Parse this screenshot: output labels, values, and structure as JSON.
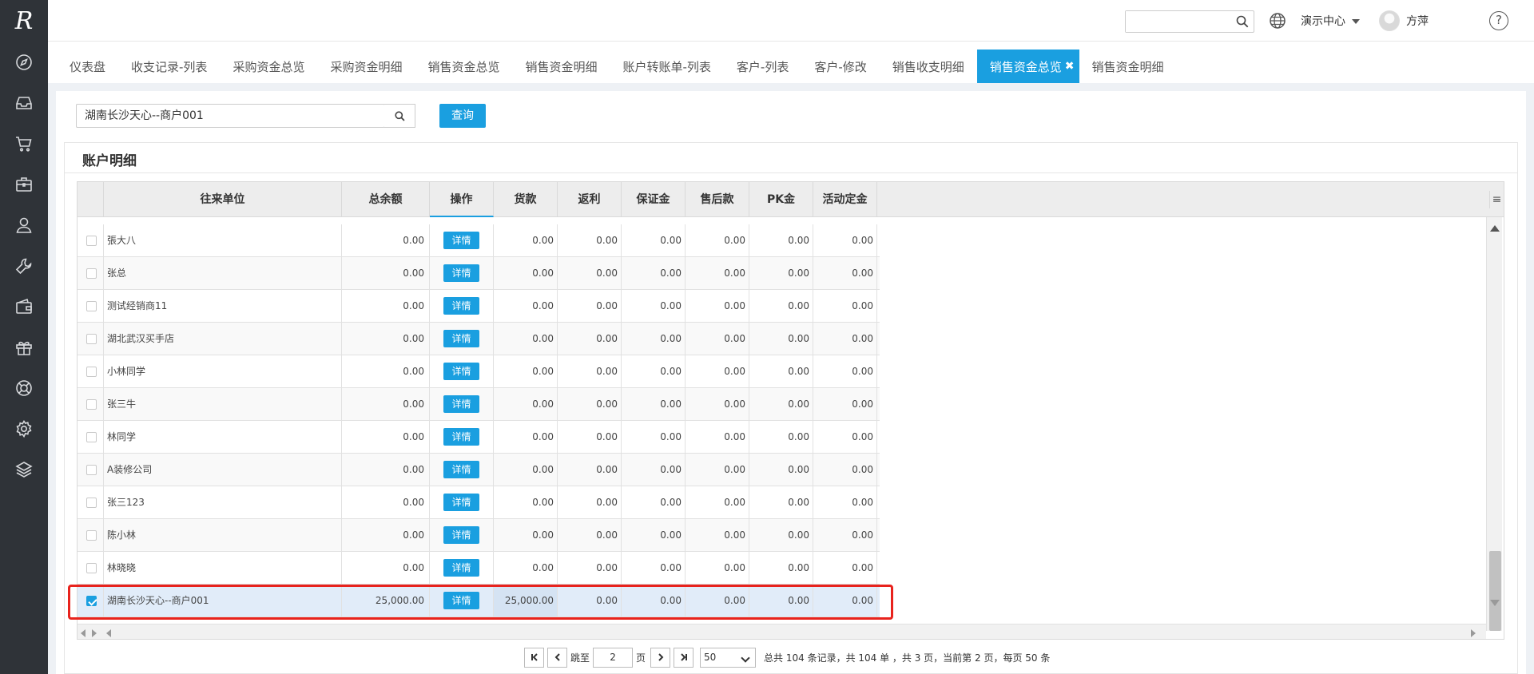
{
  "app": {
    "logo": "R"
  },
  "sidebar": {
    "icons": [
      "compass-icon",
      "inbox-icon",
      "cart-icon",
      "briefcase-icon",
      "user-icon",
      "wrench-icon",
      "wallet-icon",
      "gift-icon",
      "lifebuoy-icon",
      "gear-icon",
      "layers-icon"
    ]
  },
  "header": {
    "search_placeholder": "",
    "center_label": "演示中心",
    "user_name": "方萍",
    "help_glyph": "?"
  },
  "tabs": [
    {
      "label": "仪表盘"
    },
    {
      "label": "收支记录-列表"
    },
    {
      "label": "采购资金总览"
    },
    {
      "label": "采购资金明细"
    },
    {
      "label": "销售资金总览"
    },
    {
      "label": "销售资金明细"
    },
    {
      "label": "账户转账单-列表"
    },
    {
      "label": "客户-列表"
    },
    {
      "label": "客户-修改"
    },
    {
      "label": "销售收支明细"
    },
    {
      "label": "销售资金总览",
      "active": true
    },
    {
      "label": "销售资金明细"
    }
  ],
  "query": {
    "value": "湖南长沙天心--商户001",
    "button_label": "查询"
  },
  "section": {
    "title": "账户明细"
  },
  "grid": {
    "columns": [
      "往来单位",
      "总余额",
      "操作",
      "货款",
      "返利",
      "保证金",
      "售后款",
      "PK金",
      "活动定金"
    ],
    "detail_label": "详情",
    "rows": [
      {
        "name": "張大八",
        "total": "0.00",
        "amounts": [
          "0.00",
          "0.00",
          "0.00",
          "0.00",
          "0.00",
          "0.00"
        ],
        "checked": false
      },
      {
        "name": "张总",
        "total": "0.00",
        "amounts": [
          "0.00",
          "0.00",
          "0.00",
          "0.00",
          "0.00",
          "0.00"
        ],
        "checked": false
      },
      {
        "name": "测试经销商11",
        "total": "0.00",
        "amounts": [
          "0.00",
          "0.00",
          "0.00",
          "0.00",
          "0.00",
          "0.00"
        ],
        "checked": false
      },
      {
        "name": "湖北武汉买手店",
        "total": "0.00",
        "amounts": [
          "0.00",
          "0.00",
          "0.00",
          "0.00",
          "0.00",
          "0.00"
        ],
        "checked": false
      },
      {
        "name": "小林同学",
        "total": "0.00",
        "amounts": [
          "0.00",
          "0.00",
          "0.00",
          "0.00",
          "0.00",
          "0.00"
        ],
        "checked": false
      },
      {
        "name": "张三牛",
        "total": "0.00",
        "amounts": [
          "0.00",
          "0.00",
          "0.00",
          "0.00",
          "0.00",
          "0.00"
        ],
        "checked": false
      },
      {
        "name": "林同学",
        "total": "0.00",
        "amounts": [
          "0.00",
          "0.00",
          "0.00",
          "0.00",
          "0.00",
          "0.00"
        ],
        "checked": false
      },
      {
        "name": "A装修公司",
        "total": "0.00",
        "amounts": [
          "0.00",
          "0.00",
          "0.00",
          "0.00",
          "0.00",
          "0.00"
        ],
        "checked": false
      },
      {
        "name": "张三123",
        "total": "0.00",
        "amounts": [
          "0.00",
          "0.00",
          "0.00",
          "0.00",
          "0.00",
          "0.00"
        ],
        "checked": false
      },
      {
        "name": "陈小林",
        "total": "0.00",
        "amounts": [
          "0.00",
          "0.00",
          "0.00",
          "0.00",
          "0.00",
          "0.00"
        ],
        "checked": false
      },
      {
        "name": "林晓晓",
        "total": "0.00",
        "amounts": [
          "0.00",
          "0.00",
          "0.00",
          "0.00",
          "0.00",
          "0.00"
        ],
        "checked": false
      },
      {
        "name": "湖南长沙天心--商户001",
        "total": "25,000.00",
        "amounts": [
          "25,000.00",
          "0.00",
          "0.00",
          "0.00",
          "0.00",
          "0.00"
        ],
        "checked": true
      }
    ]
  },
  "pager": {
    "jump_label": "跳至",
    "page_value": "2",
    "page_unit": "页",
    "page_size": "50",
    "summary": "总共 104 条记录，共 104 单 ，共 3 页，当前第 2 页，每页 50 条"
  },
  "colors": {
    "accent": "#1a9fe0",
    "sidebar": "#2f3338",
    "highlight": "#e8231d"
  }
}
